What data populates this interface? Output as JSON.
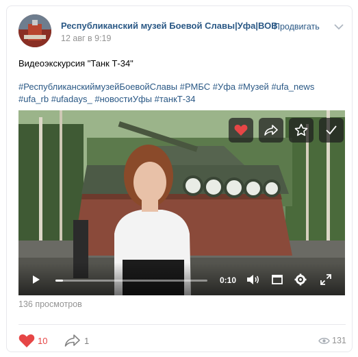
{
  "post": {
    "author": "Республиканский музей Боевой Славы|Уфа|ВОВ",
    "date": "12 авг в 9:19",
    "promote_label": "Продвигать",
    "title": "Видеоэкскурсия \"Танк Т-34\"",
    "hashtags": [
      "#РеспубликанскиймузейБоевойСлавы",
      "#РМБС",
      "#Уфа",
      "#Музей",
      "#ufa_news",
      "#ufa_rb",
      "#ufadays_",
      "#новостиУфы",
      "#танкТ-34"
    ]
  },
  "video": {
    "time": "0:10",
    "progress": 0.05,
    "views_label": "136 просмотров",
    "overlay_icons": [
      "heart-icon",
      "share-icon",
      "star-icon",
      "check-icon"
    ],
    "control_icons": [
      "play-icon",
      "volume-icon",
      "miniplayer-icon",
      "settings-icon",
      "fullscreen-icon"
    ]
  },
  "footer": {
    "likes": "10",
    "shares": "1",
    "views": "131"
  },
  "colors": {
    "link": "#2a5885",
    "like": "#e64646",
    "muted": "#939393"
  }
}
